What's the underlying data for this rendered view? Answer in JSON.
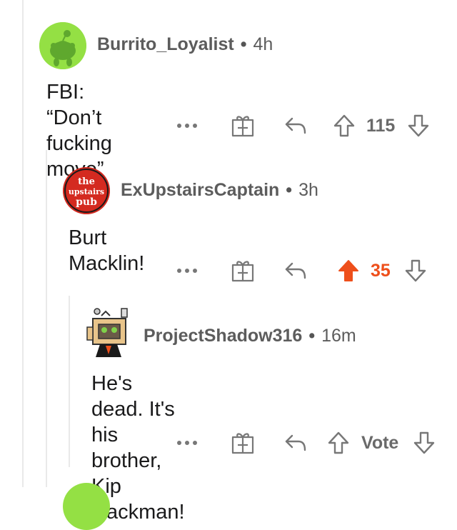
{
  "colors": {
    "upvote_active": "#ee4f1b",
    "meta_text": "#5c5c5c",
    "icon": "#777777"
  },
  "comments": [
    {
      "username": "Burrito_Loyalist",
      "separator": "•",
      "time": "4h",
      "text": "FBI: “Don’t fucking move”",
      "more": "...",
      "score": "115",
      "upvoted": false,
      "avatar_icon": "snoo-avatar-icon"
    },
    {
      "username": "ExUpstairsCaptain",
      "separator": "•",
      "time": "3h",
      "text": "Burt Macklin!",
      "more": "...",
      "score": "35",
      "upvoted": true,
      "avatar_icon": "upstairs-pub-avatar-icon",
      "avatar_text": [
        "the",
        "upstairs",
        "pub"
      ]
    },
    {
      "username": "ProjectShadow316",
      "separator": "•",
      "time": "16m",
      "text_line1": "He's dead.  It's his brother, Kip",
      "text_line2": "Hackman!",
      "more": "...",
      "score": "Vote",
      "upvoted": false,
      "avatar_icon": "robot-avatar-icon"
    }
  ]
}
